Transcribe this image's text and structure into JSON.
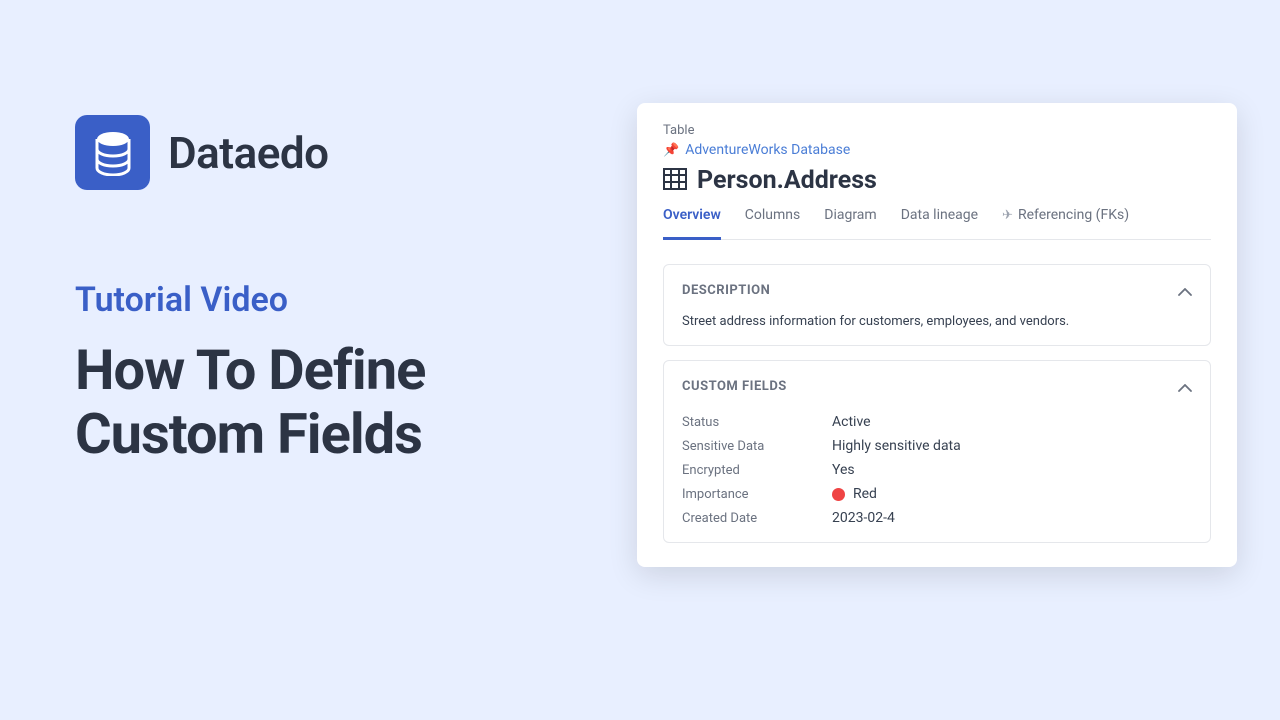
{
  "brand": {
    "name": "Dataedo"
  },
  "left": {
    "subtitle": "Tutorial Video",
    "title_line1": "How To Define",
    "title_line2": "Custom Fields"
  },
  "panel": {
    "type_label": "Table",
    "breadcrumb": "AdventureWorks Database",
    "object_name": "Person.Address",
    "tabs": [
      {
        "label": "Overview",
        "active": true
      },
      {
        "label": "Columns",
        "active": false
      },
      {
        "label": "Diagram",
        "active": false
      },
      {
        "label": "Data lineage",
        "active": false
      },
      {
        "label": "Referencing (FKs)",
        "active": false,
        "icon": true
      }
    ],
    "description": {
      "title": "DESCRIPTION",
      "text": "Street address information for customers, employees, and vendors."
    },
    "custom_fields": {
      "title": "CUSTOM FIELDS",
      "rows": [
        {
          "label": "Status",
          "value": "Active"
        },
        {
          "label": "Sensitive Data",
          "value": "Highly sensitive data"
        },
        {
          "label": "Encrypted",
          "value": "Yes"
        },
        {
          "label": "Importance",
          "value": "Red",
          "dot": "red"
        },
        {
          "label": "Created Date",
          "value": "2023-02-4"
        }
      ]
    }
  }
}
